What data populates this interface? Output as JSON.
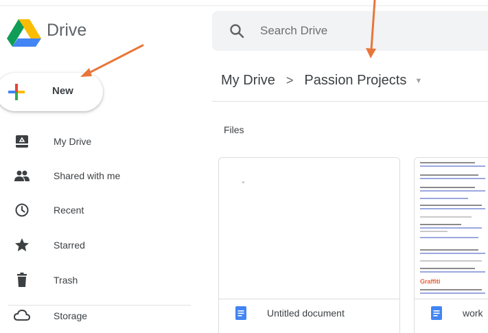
{
  "app": {
    "name": "Drive"
  },
  "search": {
    "placeholder": "Search Drive"
  },
  "new_button": {
    "label": "New"
  },
  "sidebar": {
    "items": [
      {
        "label": "My Drive",
        "icon": "my-drive-icon"
      },
      {
        "label": "Shared with me",
        "icon": "people-icon"
      },
      {
        "label": "Recent",
        "icon": "clock-icon"
      },
      {
        "label": "Starred",
        "icon": "star-icon"
      },
      {
        "label": "Trash",
        "icon": "trash-icon"
      },
      {
        "label": "Storage",
        "icon": "cloud-icon"
      }
    ]
  },
  "breadcrumb": {
    "items": [
      "My Drive",
      "Passion Projects"
    ],
    "separator": ">"
  },
  "files": {
    "heading": "Files",
    "items": [
      {
        "name": "Untitled document"
      },
      {
        "name": "work"
      }
    ],
    "preview_highlight": "Graffiti"
  },
  "colors": {
    "accent_orange": "#e8763a",
    "doc_blue": "#4285f4"
  }
}
